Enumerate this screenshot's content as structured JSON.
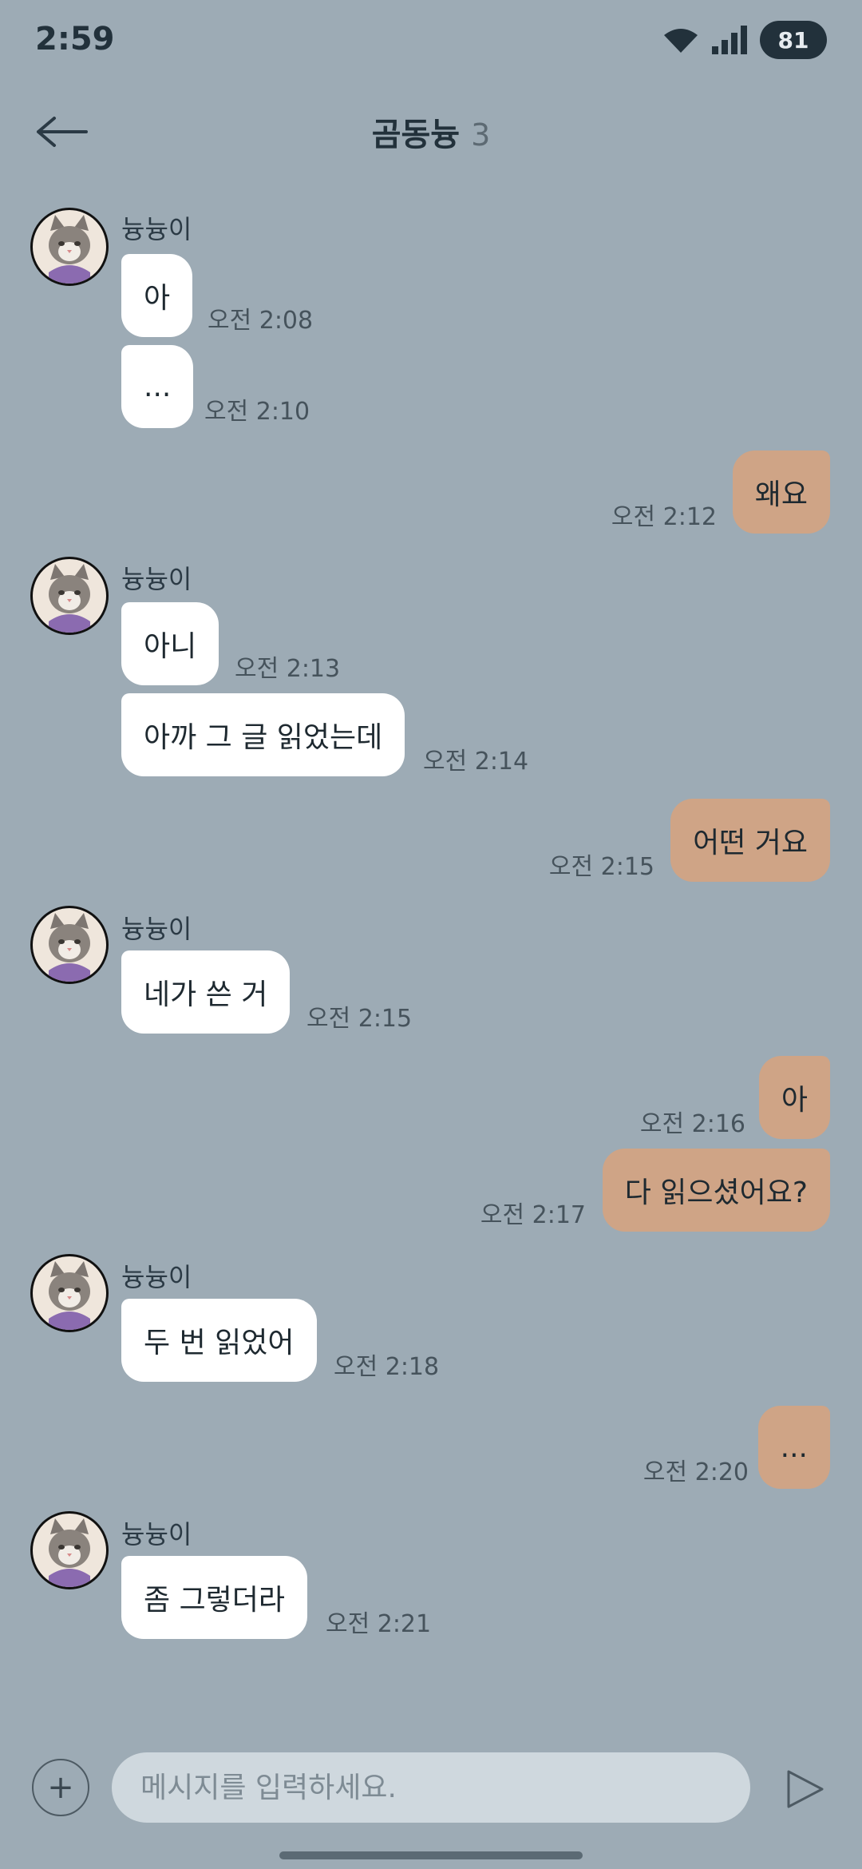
{
  "status": {
    "time": "2:59",
    "battery": "81"
  },
  "header": {
    "title": "곰동늉",
    "member_count": "3"
  },
  "messages": [
    {
      "sender": "늉늉이",
      "text": "아",
      "time": "오전 2:08"
    },
    {
      "text": "...",
      "time": "오전 2:10"
    },
    {
      "text": "왜요",
      "time": "오전 2:12"
    },
    {
      "sender": "늉늉이",
      "text": "아니",
      "time": "오전 2:13"
    },
    {
      "text": "아까 그 글 읽었는데",
      "time": "오전 2:14"
    },
    {
      "text": "어떤 거요",
      "time": "오전 2:15"
    },
    {
      "sender": "늉늉이",
      "text": "네가 쓴 거",
      "time": "오전 2:15"
    },
    {
      "text": "아",
      "time": "오전 2:16"
    },
    {
      "text": "다 읽으셨어요?",
      "time": "오전 2:17"
    },
    {
      "sender": "늉늉이",
      "text": "두 번 읽었어",
      "time": "오전 2:18"
    },
    {
      "text": "...",
      "time": "오전 2:20"
    },
    {
      "sender": "늉늉이",
      "text": "좀 그렇더라",
      "time": "오전 2:21"
    }
  ],
  "composer": {
    "placeholder": "메시지를 입력하세요.",
    "plus_label": "+"
  },
  "colors": {
    "background": "#9dabb5",
    "incoming_bubble": "#ffffff",
    "outgoing_bubble": "#cfa486"
  },
  "icons": {
    "back": "arrow-left-icon",
    "send": "send-icon",
    "wifi": "wifi-icon",
    "signal": "signal-icon"
  }
}
